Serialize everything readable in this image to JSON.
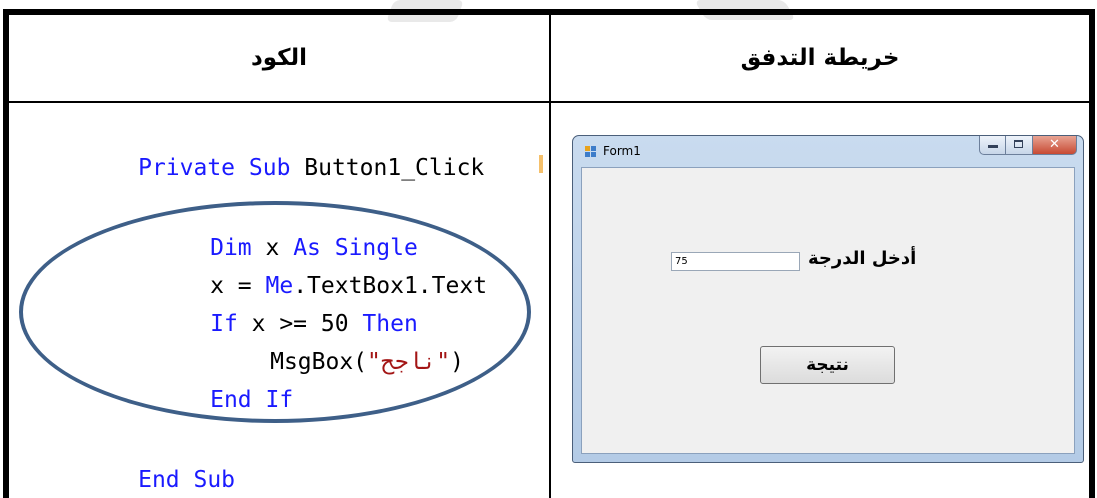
{
  "table": {
    "header_code": "الكود",
    "header_flowchart": "خريطة التدفق"
  },
  "code": {
    "line1": {
      "kw1": "Private Sub",
      "rest": " Button1_Click"
    },
    "line2": {
      "kw1": "Dim",
      "mid": " x ",
      "kw2": "As Single"
    },
    "line3": {
      "lhs": "x = ",
      "kw": "Me",
      "rhs": ".TextBox1.Text"
    },
    "line4": {
      "kw1": "If",
      "mid": " x >= 50 ",
      "kw2": "Then"
    },
    "line5": {
      "pre": "MsgBox(",
      "str": "\"ناجح\"",
      "post": ")"
    },
    "line6": {
      "kw": "End If"
    },
    "line7": {
      "kw": "End Sub"
    }
  },
  "form": {
    "title": "Form1",
    "textbox_value": "75",
    "label": "أدخل الدرجة",
    "button_label": "نتيجة"
  },
  "colors": {
    "keyword": "#1a1aff",
    "string": "#a31515",
    "highlight_ellipse": "#3e5f88"
  }
}
